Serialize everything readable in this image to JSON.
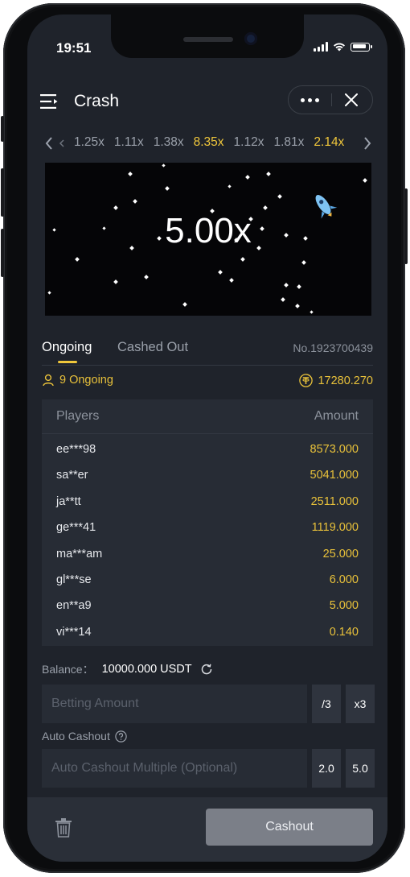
{
  "status_bar": {
    "time": "19:51"
  },
  "header": {
    "title": "Crash"
  },
  "history": {
    "items": [
      {
        "label": "1.25x",
        "highlight": false
      },
      {
        "label": "1.11x",
        "highlight": false
      },
      {
        "label": "1.38x",
        "highlight": false
      },
      {
        "label": "8.35x",
        "highlight": true
      },
      {
        "label": "1.12x",
        "highlight": false
      },
      {
        "label": "1.81x",
        "highlight": false
      },
      {
        "label": "2.14x",
        "highlight": true
      }
    ]
  },
  "game": {
    "multiplier": "5.00x"
  },
  "tabs": {
    "ongoing": "Ongoing",
    "cashed_out": "Cashed Out",
    "round_no": "No.1923700439"
  },
  "summary": {
    "ongoing": "9 Ongoing",
    "total": "17280.270"
  },
  "table": {
    "headers": {
      "players": "Players",
      "amount": "Amount"
    },
    "rows": [
      {
        "player": "ee***98",
        "amount": "8573.000"
      },
      {
        "player": "sa**er",
        "amount": "5041.000"
      },
      {
        "player": "ja**tt",
        "amount": "2511.000"
      },
      {
        "player": "ge***41",
        "amount": "1119.000"
      },
      {
        "player": "ma***am",
        "amount": "25.000"
      },
      {
        "player": "gl***se",
        "amount": "6.000"
      },
      {
        "player": "en**a9",
        "amount": "5.000"
      },
      {
        "player": "vi***14",
        "amount": "0.140"
      }
    ]
  },
  "balance": {
    "label": "Balance：",
    "value": "10000.000 USDT"
  },
  "betting": {
    "placeholder": "Betting Amount",
    "half": "/3",
    "triple": "x3"
  },
  "auto_cashout": {
    "label": "Auto Cashout",
    "placeholder": "Auto Cashout Multiple (Optional)",
    "opt1": "2.0",
    "opt2": "5.0"
  },
  "actions": {
    "cashout": "Cashout"
  },
  "colors": {
    "accent": "#f0c73b",
    "background": "#1f232b",
    "panel": "#272c35",
    "button_disabled": "#7b7f88"
  }
}
